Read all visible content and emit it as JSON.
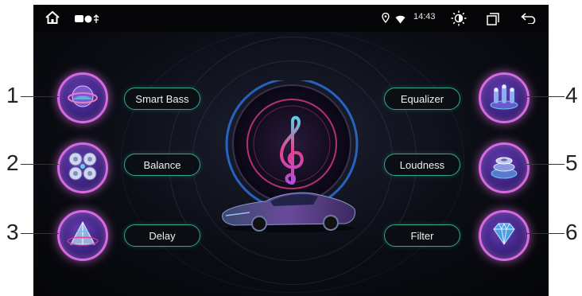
{
  "status_bar": {
    "time": "14:43",
    "icons": [
      "home-icon",
      "notification-icons",
      "location-icon",
      "wifi-icon",
      "brightness-icon",
      "recent-apps-icon",
      "back-icon"
    ]
  },
  "left_buttons": [
    {
      "label": "Smart Bass",
      "icon": "bass-sphere-icon",
      "callout": "1"
    },
    {
      "label": "Balance",
      "icon": "speakers-icon",
      "callout": "2"
    },
    {
      "label": "Delay",
      "icon": "pyramid-icon",
      "callout": "3"
    }
  ],
  "right_buttons": [
    {
      "label": "Equalizer",
      "icon": "equalizer-icon",
      "callout": "4"
    },
    {
      "label": "Loudness",
      "icon": "loudness-icon",
      "callout": "5"
    },
    {
      "label": "Filter",
      "icon": "diamond-icon",
      "callout": "6"
    }
  ],
  "center": {
    "icon": "treble-clef-icon",
    "image": "car-image"
  },
  "colors": {
    "accent_teal": "#2fa88e",
    "orb_glow": "#d66ae0",
    "clef_pink": "#e8408a"
  }
}
